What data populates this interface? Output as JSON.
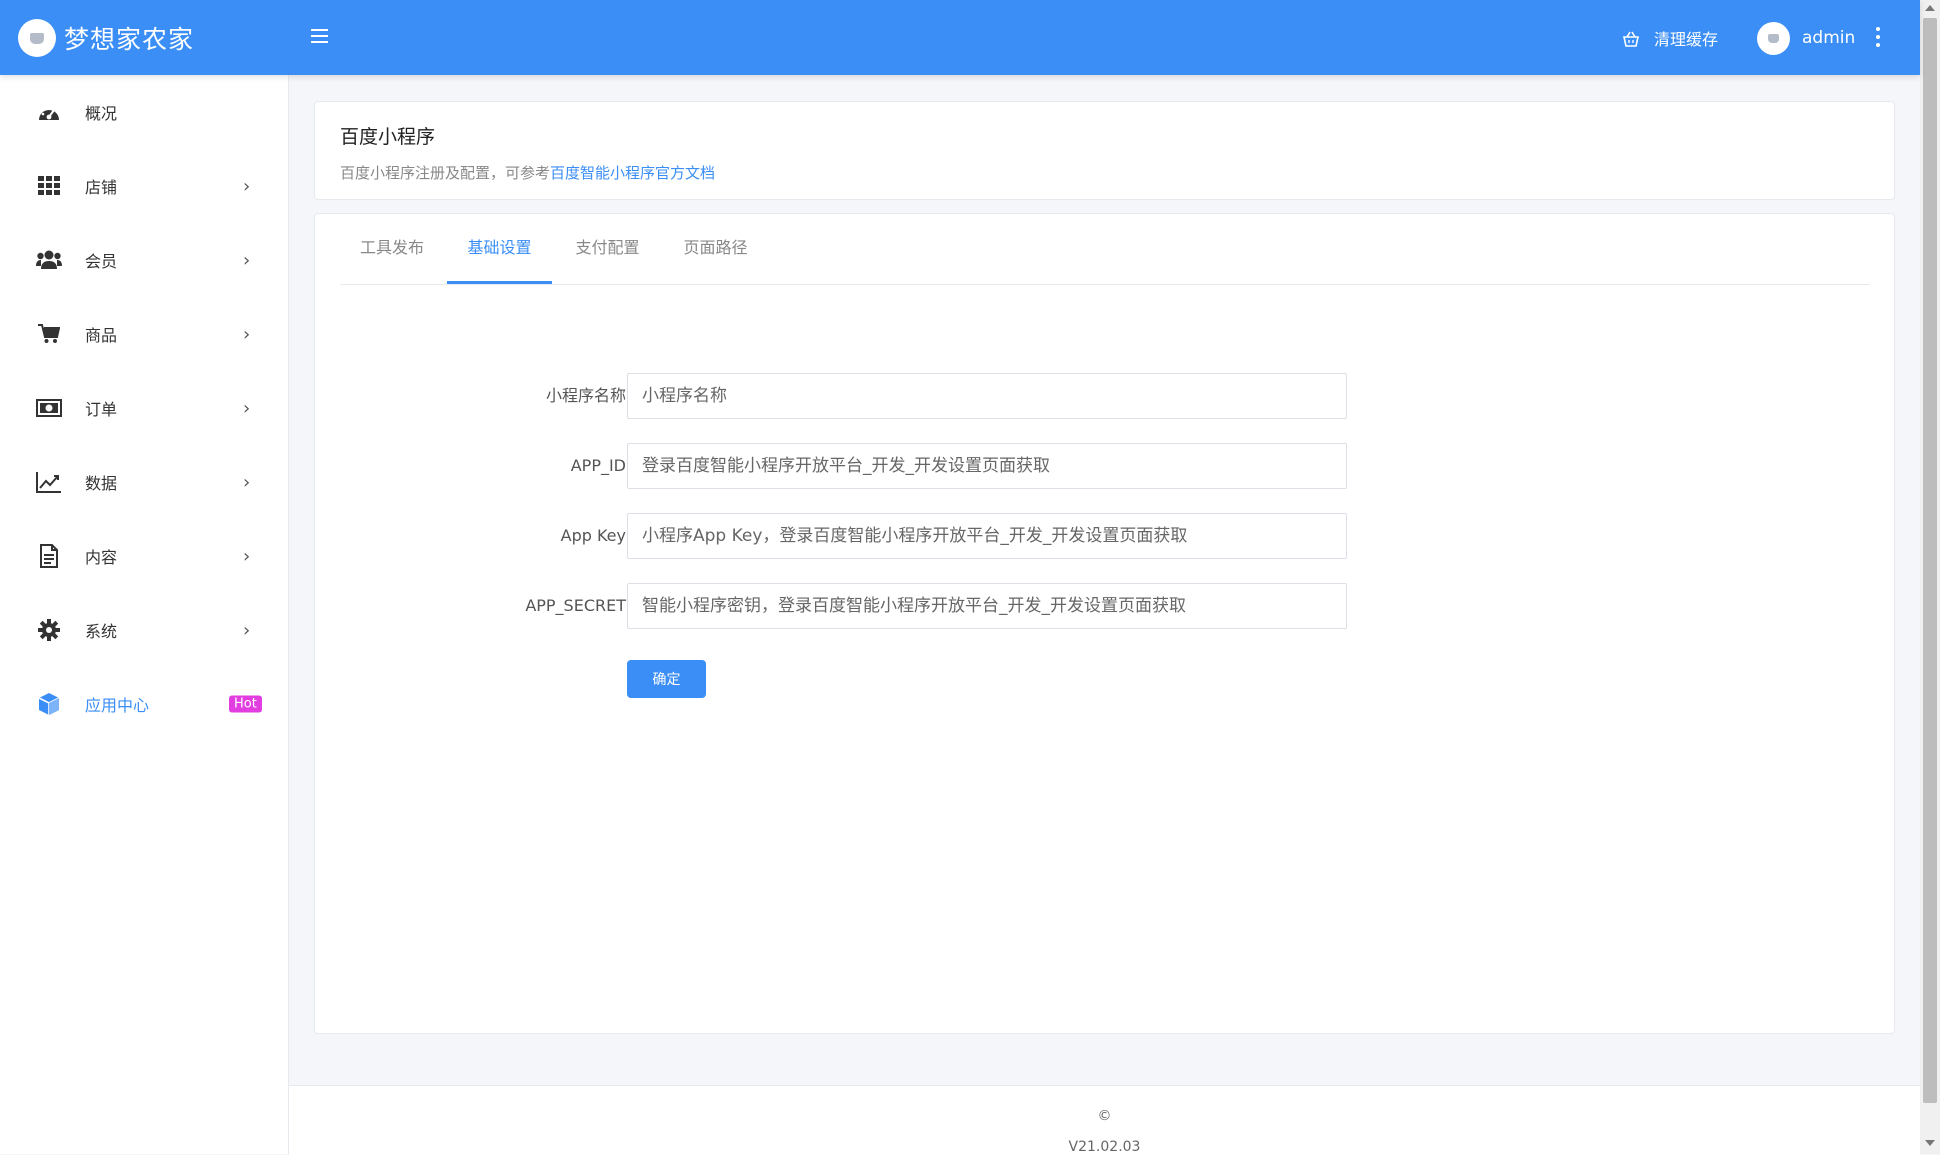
{
  "app": {
    "title": "梦想家农家"
  },
  "header": {
    "clear_cache": "清理缓存",
    "username": "admin"
  },
  "sidebar": {
    "items": [
      {
        "label": "概况",
        "icon": "dashboard-icon",
        "has_children": false
      },
      {
        "label": "店铺",
        "icon": "grid-icon",
        "has_children": true
      },
      {
        "label": "会员",
        "icon": "users-icon",
        "has_children": true
      },
      {
        "label": "商品",
        "icon": "cart-icon",
        "has_children": true
      },
      {
        "label": "订单",
        "icon": "money-bill-icon",
        "has_children": true
      },
      {
        "label": "数据",
        "icon": "line-chart-icon",
        "has_children": true
      },
      {
        "label": "内容",
        "icon": "document-icon",
        "has_children": true
      },
      {
        "label": "系统",
        "icon": "gear-icon",
        "has_children": true
      },
      {
        "label": "应用中心",
        "icon": "cube-icon",
        "has_children": false,
        "active": true,
        "badge": "Hot"
      }
    ],
    "arrow": "›"
  },
  "page": {
    "title": "百度小程序",
    "description": "百度小程序注册及配置，可参考",
    "doc_link": "百度智能小程序官方文档"
  },
  "tabs": [
    {
      "label": "工具发布",
      "active": false
    },
    {
      "label": "基础设置",
      "active": true
    },
    {
      "label": "支付配置",
      "active": false
    },
    {
      "label": "页面路径",
      "active": false
    }
  ],
  "form": {
    "fields": [
      {
        "label": "小程序名称",
        "value": "",
        "placeholder": "小程序名称"
      },
      {
        "label": "APP_ID",
        "value": "",
        "placeholder": "登录百度智能小程序开放平台_开发_开发设置页面获取"
      },
      {
        "label": "App Key",
        "value": "",
        "placeholder": "小程序App Key，登录百度智能小程序开放平台_开发_开发设置页面获取"
      },
      {
        "label": "APP_SECRET",
        "value": "",
        "placeholder": "智能小程序密钥，登录百度智能小程序开放平台_开发_开发设置页面获取"
      }
    ],
    "submit_label": "确定"
  },
  "footer": {
    "copyright": "©",
    "version": "V21.02.03"
  },
  "colors": {
    "primary": "#3a8ef6",
    "hot_badge": "#e23de0",
    "background": "#f4f6fa"
  }
}
